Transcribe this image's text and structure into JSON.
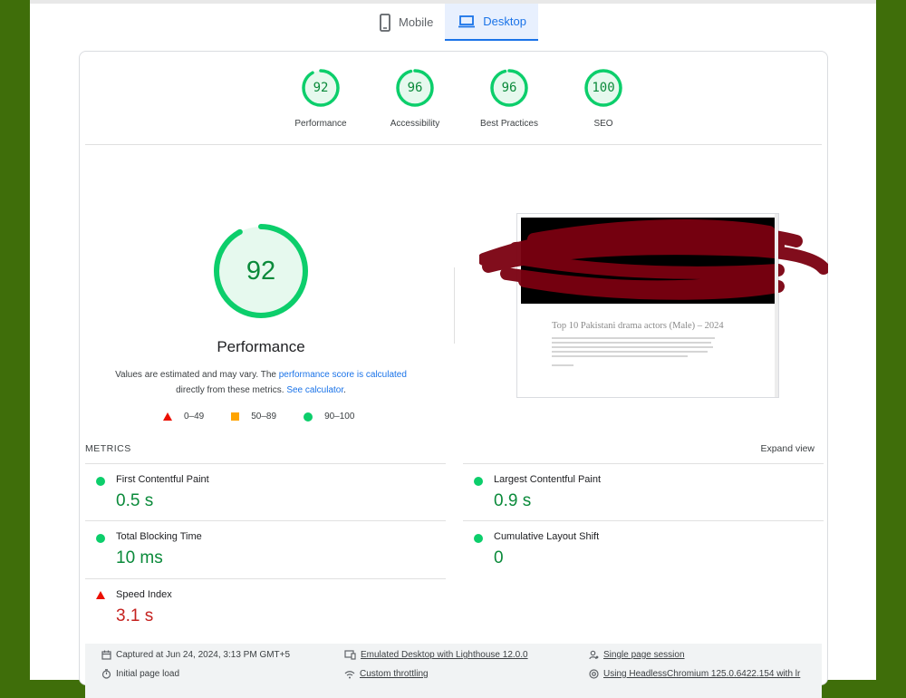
{
  "tabs": [
    {
      "label": "Mobile",
      "active": false
    },
    {
      "label": "Desktop",
      "active": true
    }
  ],
  "categories": [
    {
      "label": "Performance",
      "score": "92",
      "value": 92
    },
    {
      "label": "Accessibility",
      "score": "96",
      "value": 96
    },
    {
      "label": "Best Practices",
      "score": "96",
      "value": 96
    },
    {
      "label": "SEO",
      "score": "100",
      "value": 100
    }
  ],
  "performance": {
    "score": "92",
    "value": 92,
    "title": "Performance",
    "note_prefix": "Values are estimated and may vary. The ",
    "note_link": "performance score is calculated",
    "note_middle": " directly from these metrics. ",
    "note_link2": "See calculator",
    "note_suffix": "."
  },
  "legend": {
    "fail": "0–49",
    "average": "50–89",
    "pass": "90–100"
  },
  "screenshot": {
    "article_title": "Top 10 Pakistani drama actors (Male) – 2024"
  },
  "metrics": {
    "heading": "METRICS",
    "expand_label": "Expand view",
    "items": [
      {
        "label": "First Contentful Paint",
        "value": "0.5 s",
        "status": "pass"
      },
      {
        "label": "Largest Contentful Paint",
        "value": "0.9 s",
        "status": "pass"
      },
      {
        "label": "Total Blocking Time",
        "value": "10 ms",
        "status": "pass"
      },
      {
        "label": "Cumulative Layout Shift",
        "value": "0",
        "status": "pass"
      },
      {
        "label": "Speed Index",
        "value": "3.1 s",
        "status": "fail"
      }
    ]
  },
  "footer": {
    "captured": "Captured at Jun 24, 2024, 3:13 PM GMT+5",
    "emulated": "Emulated Desktop with Lighthouse 12.0.0",
    "session": "Single page session",
    "load": "Initial page load",
    "throttling": "Custom throttling",
    "browser": "Using HeadlessChromium 125.0.6422.154 with lr"
  },
  "colors": {
    "pass": "#0cce6b",
    "pass_text": "#0a8a3a",
    "fail": "#eb0f00",
    "average": "#ffa400",
    "accent": "#1a73e8",
    "redaction": "#7a0010"
  },
  "icons": {
    "mobile": "phone-icon",
    "desktop": "laptop-icon",
    "captured": "calendar-icon",
    "emulated": "device-icon",
    "session": "person-icon",
    "load": "timer-icon",
    "throttling": "wifi-icon",
    "browser": "chrome-icon"
  }
}
